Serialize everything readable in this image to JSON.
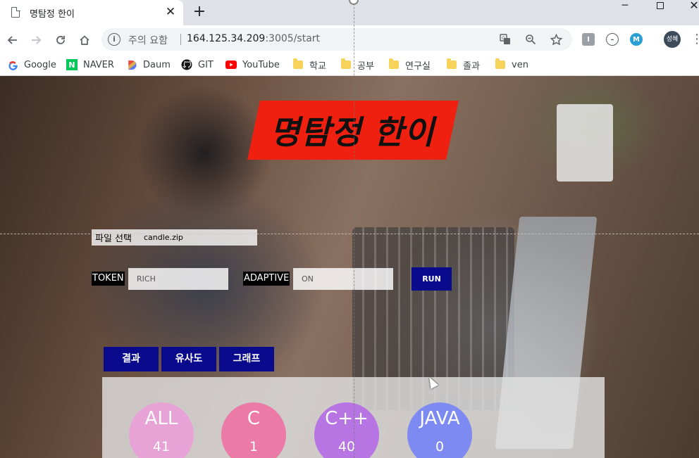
{
  "browser": {
    "tab_title": "명탐정 한이",
    "tab_close": "✕",
    "new_tab": "+",
    "security_label": "주의 요함",
    "url_host": "164.125.34.209",
    "url_rest": ":3005/start",
    "profile_initials": "성혜",
    "extension_letter": "M"
  },
  "bookmarks": [
    {
      "label": "Google",
      "icon": "google-icon",
      "color": "#4285f4"
    },
    {
      "label": "NAVER",
      "icon": "naver-icon",
      "color": "#03c75a"
    },
    {
      "label": "Daum",
      "icon": "daum-icon",
      "color": "#5b7bf3"
    },
    {
      "label": "GIT",
      "icon": "github-icon",
      "color": "#000000"
    },
    {
      "label": "YouTube",
      "icon": "youtube-icon",
      "color": "#ff0000"
    },
    {
      "label": "학교",
      "icon": "folder-icon"
    },
    {
      "label": "공부",
      "icon": "folder-icon"
    },
    {
      "label": "연구실",
      "icon": "folder-icon"
    },
    {
      "label": "졸과",
      "icon": "folder-icon"
    },
    {
      "label": "ven",
      "icon": "folder-icon"
    }
  ],
  "page": {
    "title": "명탐정 한이",
    "file_button": "파일 선택",
    "file_name": "candle.zip",
    "token_label": "TOKEN",
    "token_value": "RICH",
    "adaptive_label": "ADAPTIVE",
    "adaptive_value": "ON",
    "run_label": "RUN",
    "tabs": [
      "결과",
      "유사도",
      "그래프"
    ],
    "stats": [
      {
        "label": "ALL",
        "count": "41",
        "color": "#e7a3d6"
      },
      {
        "label": "C",
        "count": "1",
        "color": "#ec7aa6"
      },
      {
        "label": "C++",
        "count": "40",
        "color": "#b774e3"
      },
      {
        "label": "JAVA",
        "count": "0",
        "color": "#7d8af1"
      }
    ]
  },
  "colors": {
    "title_banner": "#f02010",
    "primary_button": "#0a0a8c"
  }
}
